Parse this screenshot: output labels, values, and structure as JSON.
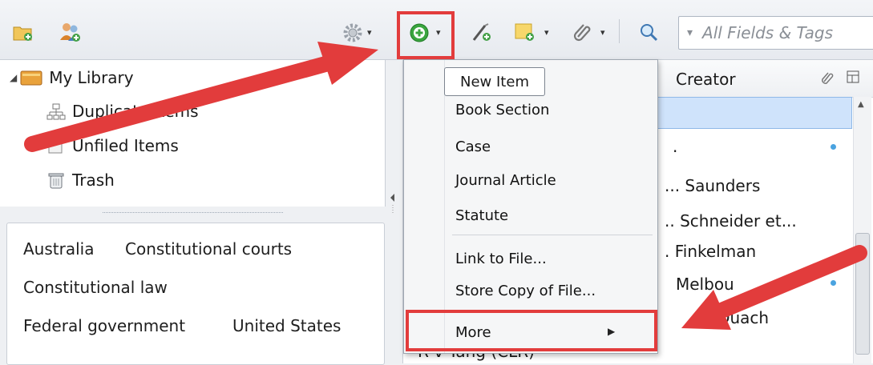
{
  "toolbar": {
    "new_collection_icon": "folder-add-icon",
    "new_group_icon": "users-add-icon",
    "actions_icon": "gear-icon",
    "new_item_icon": "plus-circle-icon",
    "new_item_from_id_icon": "wand-icon",
    "new_note_icon": "note-add-icon",
    "attachment_icon": "paperclip-icon",
    "locate_icon": "magnifier-icon",
    "search": {
      "mode_caret": "▾",
      "placeholder": "All Fields & Tags"
    }
  },
  "library": {
    "root": "My Library",
    "items": [
      "Duplicate Items",
      "Unfiled Items",
      "Trash"
    ]
  },
  "tags": {
    "rows": [
      [
        "Australia",
        "Constitutional courts"
      ],
      [
        "Constitutional law"
      ],
      [
        "Federal government",
        "United States"
      ]
    ]
  },
  "items_table": {
    "header_creator": "Creator",
    "rows": [
      {
        "creator": "",
        "selected": true
      },
      {
        "creator": ".",
        "dot": true
      },
      {
        "creator": "... Saunders"
      },
      {
        "creator": ".. Schneider et..."
      },
      {
        "creator": ". Finkelman"
      },
      {
        "creator": "Melbou",
        "dot": true
      },
      {
        "creator": "ng Quach"
      },
      {
        "creator": "R v Tang (CLR)"
      }
    ]
  },
  "new_item_menu": {
    "tooltip": "New Item",
    "items": [
      "Book Section",
      "Case",
      "Journal Article",
      "Statute"
    ],
    "file_items": [
      "Link to File...",
      "Store Copy of File..."
    ],
    "more": "More",
    "more_arrow": "▶"
  },
  "annotation_color": "#e23c3c",
  "selection_color": "#cfe3fb"
}
